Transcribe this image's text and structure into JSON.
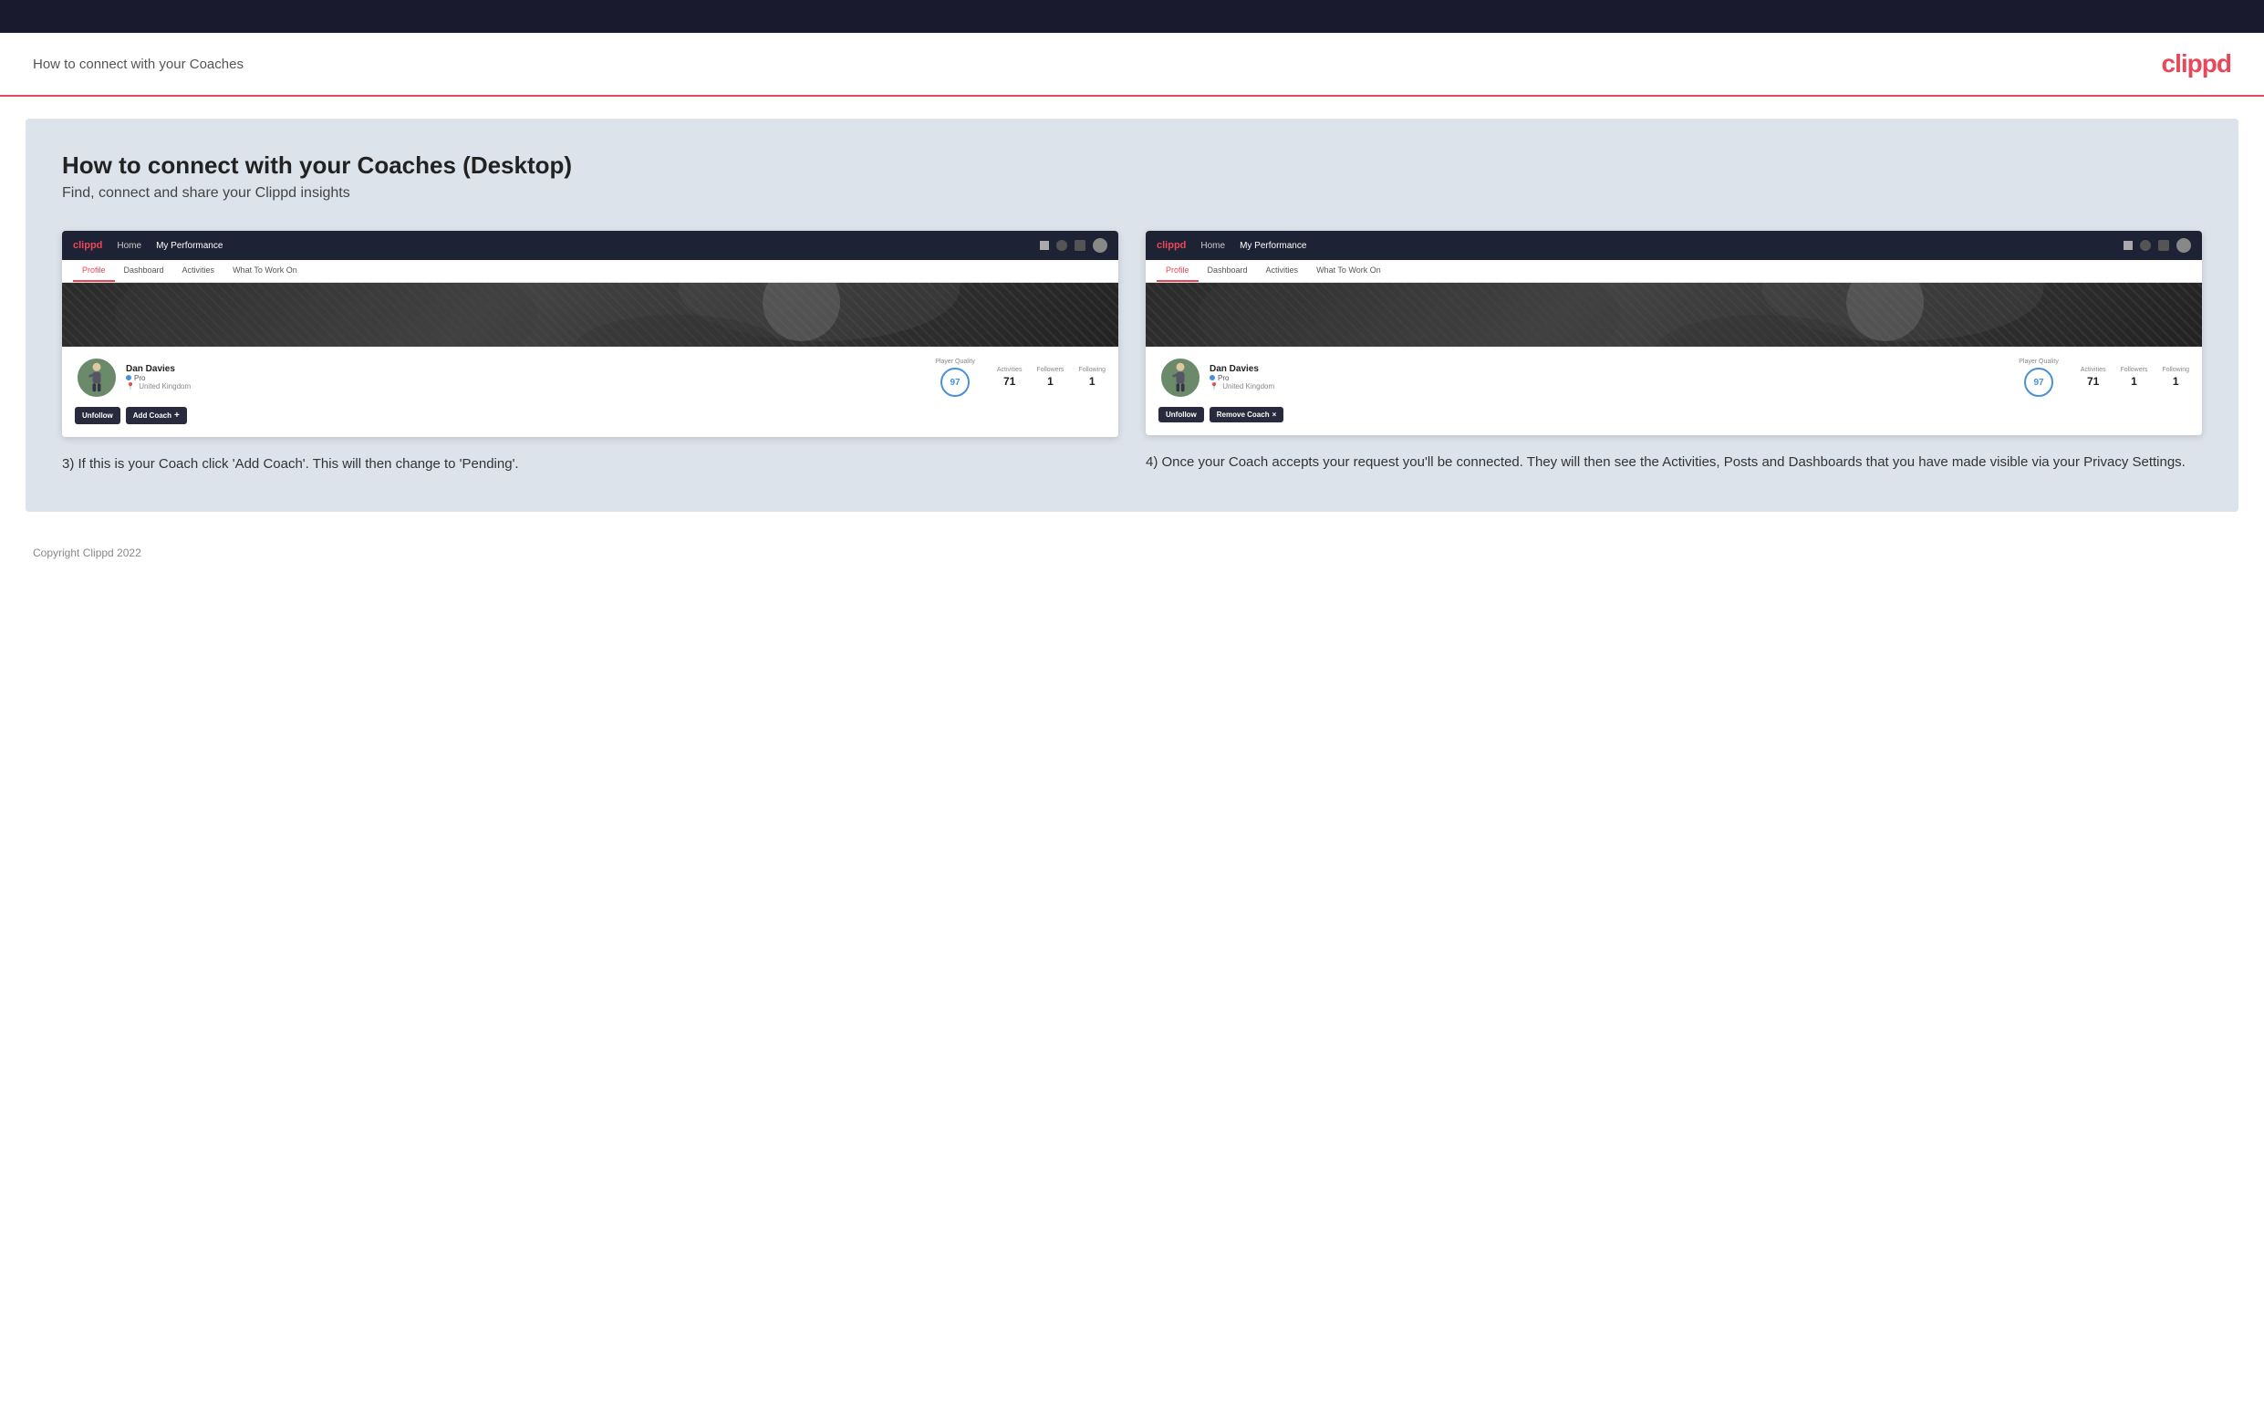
{
  "topbar": {},
  "header": {
    "title": "How to connect with your Coaches",
    "logo": "clippd"
  },
  "main": {
    "title": "How to connect with your Coaches (Desktop)",
    "subtitle": "Find, connect and share your Clippd insights",
    "left": {
      "mock_nav": {
        "logo": "clippd",
        "items": [
          "Home",
          "My Performance"
        ]
      },
      "mock_tabs": [
        "Profile",
        "Dashboard",
        "Activities",
        "What To Work On"
      ],
      "active_tab": "Profile",
      "player_name": "Dan Davies",
      "player_role": "Pro",
      "player_location": "United Kingdom",
      "player_quality_label": "Player Quality",
      "player_quality_value": "97",
      "stats": [
        {
          "label": "Activities",
          "value": "71"
        },
        {
          "label": "Followers",
          "value": "1"
        },
        {
          "label": "Following",
          "value": "1"
        }
      ],
      "btn_unfollow": "Unfollow",
      "btn_add_coach": "Add Coach",
      "btn_add_icon": "+",
      "description": "3) If this is your Coach click 'Add Coach'. This will then change to 'Pending'."
    },
    "right": {
      "mock_nav": {
        "logo": "clippd",
        "items": [
          "Home",
          "My Performance"
        ]
      },
      "mock_tabs": [
        "Profile",
        "Dashboard",
        "Activities",
        "What To Work On"
      ],
      "active_tab": "Profile",
      "player_name": "Dan Davies",
      "player_role": "Pro",
      "player_location": "United Kingdom",
      "player_quality_label": "Player Quality",
      "player_quality_value": "97",
      "stats": [
        {
          "label": "Activities",
          "value": "71"
        },
        {
          "label": "Followers",
          "value": "1"
        },
        {
          "label": "Following",
          "value": "1"
        }
      ],
      "btn_unfollow": "Unfollow",
      "btn_remove_coach": "Remove Coach",
      "btn_remove_icon": "×",
      "description": "4) Once your Coach accepts your request you'll be connected. They will then see the Activities, Posts and Dashboards that you have made visible via your Privacy Settings."
    }
  },
  "footer": {
    "copyright": "Copyright Clippd 2022"
  }
}
